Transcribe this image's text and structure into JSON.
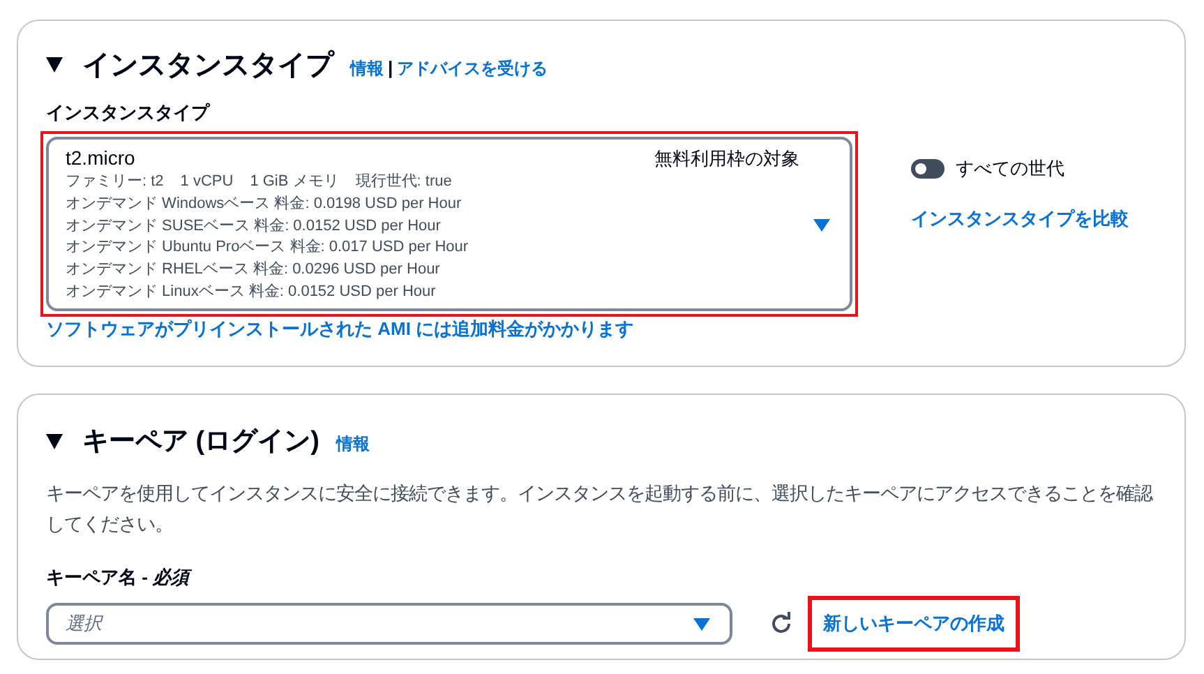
{
  "instance_type_panel": {
    "expanded": true,
    "title": "インスタンスタイプ",
    "info_link": "情報",
    "separator": "|",
    "advice_link": "アドバイスを受ける",
    "field_label": "インスタンスタイプ",
    "select": {
      "highlighted": true,
      "name": "t2.micro",
      "badge": "無料利用枠の対象",
      "details": [
        "ファミリー: t2",
        "1 vCPU",
        "1 GiB メモリ",
        "現行世代: true"
      ],
      "prices": [
        "オンデマンド Windowsベース 料金: 0.0198 USD per Hour",
        "オンデマンド SUSEベース 料金: 0.0152 USD per Hour",
        "オンデマンド Ubuntu Proベース 料金: 0.017 USD per Hour",
        "オンデマンド RHELベース 料金: 0.0296 USD per Hour",
        "オンデマンド Linuxベース 料金: 0.0152 USD per Hour"
      ]
    },
    "ami_note_link": "ソフトウェアがプリインストールされた AMI には追加料金がかかります",
    "all_generations_toggle": {
      "label": "すべての世代",
      "on": false
    },
    "compare_link": "インスタンスタイプを比較"
  },
  "key_pair_panel": {
    "expanded": true,
    "title": "キーペア (ログイン)",
    "info_link": "情報",
    "description": "キーペアを使用してインスタンスに安全に接続できます。インスタンスを起動する前に、選択したキーペアにアクセスできることを確認してください。",
    "field_label": "キーペア名 - *必須*",
    "select": {
      "placeholder": "選択"
    },
    "create_link": {
      "label": "新しいキーペアの作成",
      "highlighted": true
    }
  }
}
